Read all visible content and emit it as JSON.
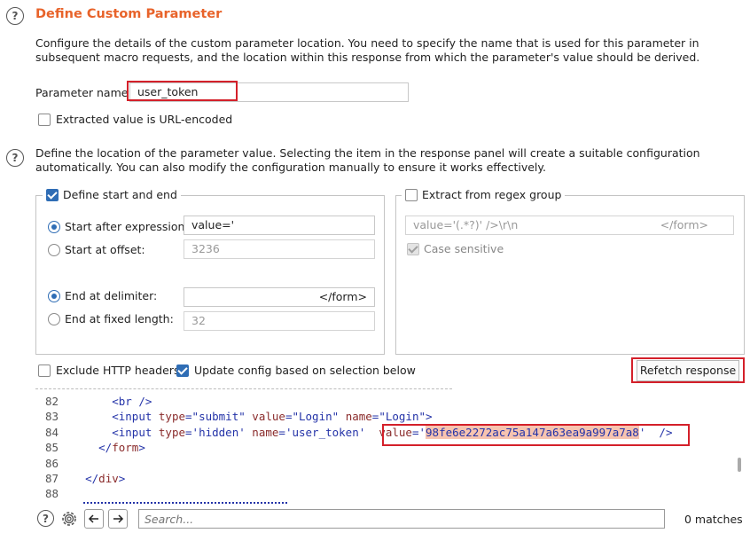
{
  "section1": {
    "title": "Define Custom Parameter",
    "description": "Configure the details of the custom parameter location. You need to specify the name that is used for this parameter in subsequent macro requests, and the location within this response from which the parameter's value should be derived.",
    "param_name_label": "Parameter name:",
    "param_name_value": "user_token",
    "url_encoded_label": "Extracted value is URL-encoded"
  },
  "section2": {
    "description": "Define the location of the parameter value. Selecting the item in the response panel will create a suitable configuration automatically. You can also modify the configuration manually to ensure it works effectively.",
    "start_end_label": "Define start and end",
    "start_after_label": "Start after expression:",
    "start_after_value": "value='",
    "start_offset_label": "Start at offset:",
    "start_offset_value": "3236",
    "end_delim_label": "End at delimiter:",
    "end_delim_value": "</form>",
    "end_fixed_label": "End at fixed length:",
    "end_fixed_value": "32",
    "regex_label": "Extract from regex group",
    "regex_value_left": "value='(.*?)' />\\r\\n",
    "regex_value_right": "</form>",
    "case_sensitive_label": "Case sensitive"
  },
  "options": {
    "exclude_headers_label": "Exclude HTTP headers",
    "update_config_label": "Update config based on selection below",
    "refetch_label": "Refetch response"
  },
  "code": {
    "lines": [
      {
        "num": "82",
        "indent": "      ",
        "parts": [
          [
            "tag",
            "<br />"
          ]
        ]
      },
      {
        "num": "83",
        "indent": "      ",
        "parts": [
          [
            "tag",
            "<input "
          ],
          [
            "attr",
            "type"
          ],
          [
            "tag",
            "="
          ],
          [
            "str",
            "\"submit\""
          ],
          [
            "tag",
            " "
          ],
          [
            "attr",
            "value"
          ],
          [
            "tag",
            "="
          ],
          [
            "str",
            "\"Login\""
          ],
          [
            "tag",
            " "
          ],
          [
            "attr",
            "name"
          ],
          [
            "tag",
            "="
          ],
          [
            "str",
            "\"Login\""
          ],
          [
            "tag",
            ">"
          ]
        ]
      },
      {
        "num": "84",
        "indent": "      ",
        "parts": [
          [
            "tag",
            "<input "
          ],
          [
            "attr",
            "type"
          ],
          [
            "tag",
            "="
          ],
          [
            "str",
            "'hidden'"
          ],
          [
            "tag",
            " "
          ],
          [
            "attr",
            "name"
          ],
          [
            "tag",
            "="
          ],
          [
            "str",
            "'user_token'"
          ],
          [
            "tag",
            "  "
          ],
          [
            "attr",
            "value"
          ],
          [
            "tag",
            "="
          ],
          [
            "str",
            "'"
          ],
          [
            "hl",
            "98fe6e2272ac75a147a63ea9a997a7a8"
          ],
          [
            "str",
            "'"
          ],
          [
            "tag",
            "  />"
          ]
        ]
      },
      {
        "num": "85",
        "indent": "    ",
        "parts": [
          [
            "tag",
            "</"
          ],
          [
            "attr",
            "form"
          ],
          [
            "tag",
            ">"
          ]
        ]
      },
      {
        "num": "86",
        "indent": "",
        "parts": []
      },
      {
        "num": "87",
        "indent": "  ",
        "parts": [
          [
            "tag",
            "</"
          ],
          [
            "attr",
            "div"
          ],
          [
            "tag",
            ">"
          ]
        ]
      },
      {
        "num": "88",
        "indent": "",
        "parts": []
      }
    ]
  },
  "footer": {
    "search_placeholder": "Search...",
    "matches": "0 matches"
  }
}
